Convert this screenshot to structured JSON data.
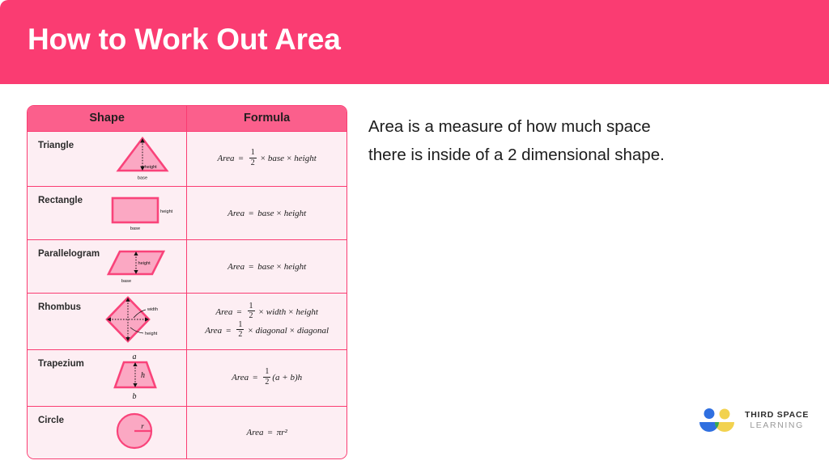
{
  "header": {
    "title": "How to Work Out Area",
    "background_color": "#fa3c72",
    "text_color": "#ffffff"
  },
  "table": {
    "columns": [
      {
        "label": "Shape"
      },
      {
        "label": "Formula"
      }
    ],
    "header_background": "#fb5f8c",
    "border_color": "#fa3c72",
    "cell_background": "#fdeef3",
    "shape_fill": "#fba8c3",
    "rows": [
      {
        "shape": "Triangle",
        "diagram": "triangle-diagram",
        "diagram_labels": {
          "height": "height",
          "base": "base"
        },
        "formulas": [
          {
            "lhs": "Area",
            "fraction": {
              "numerator": "1",
              "denominator": "2"
            },
            "terms": [
              "base",
              "height"
            ]
          }
        ]
      },
      {
        "shape": "Rectangle",
        "diagram": "rectangle-diagram",
        "diagram_labels": {
          "height": "height",
          "base": "base"
        },
        "formulas": [
          {
            "lhs": "Area",
            "fraction": null,
            "terms": [
              "base",
              "height"
            ]
          }
        ]
      },
      {
        "shape": "Parallelogram",
        "diagram": "parallelogram-diagram",
        "diagram_labels": {
          "height": "height",
          "base": "base"
        },
        "formulas": [
          {
            "lhs": "Area",
            "fraction": null,
            "terms": [
              "base",
              "height"
            ]
          }
        ]
      },
      {
        "shape": "Rhombus",
        "diagram": "rhombus-diagram",
        "diagram_labels": {
          "width": "width",
          "height": "height"
        },
        "formulas": [
          {
            "lhs": "Area",
            "fraction": {
              "numerator": "1",
              "denominator": "2"
            },
            "terms": [
              "width",
              "height"
            ]
          },
          {
            "lhs": "Area",
            "fraction": {
              "numerator": "1",
              "denominator": "2"
            },
            "terms": [
              "diagonal",
              "diagonal"
            ]
          }
        ]
      },
      {
        "shape": "Trapezium",
        "diagram": "trapezium-diagram",
        "diagram_labels": {
          "top": "a",
          "height": "h",
          "bottom": "b"
        },
        "formulas": [
          {
            "lhs": "Area",
            "fraction": {
              "numerator": "1",
              "denominator": "2"
            },
            "expression": "(a + b)h"
          }
        ]
      },
      {
        "shape": "Circle",
        "diagram": "circle-diagram",
        "diagram_labels": {
          "radius": "r"
        },
        "formulas": [
          {
            "lhs": "Area",
            "fraction": null,
            "expression": "πr²"
          }
        ]
      }
    ]
  },
  "intro": {
    "line1": "Area is a measure of how much space",
    "line2": "there is inside of a 2 dimensional shape."
  },
  "logo": {
    "line1": "THIRD SPACE",
    "line2": "LEARNING",
    "colors": {
      "blue": "#2f6fe0",
      "yellow": "#f2d24f",
      "green": "#34a853"
    }
  }
}
